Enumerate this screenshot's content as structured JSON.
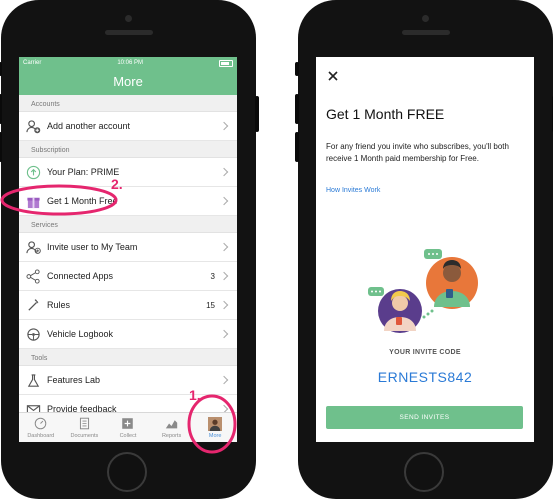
{
  "left_screen": {
    "status": {
      "carrier": "Carrier",
      "time": "10:06 PM"
    },
    "title": "More",
    "sections": {
      "accounts": "Accounts",
      "subscription": "Subscription",
      "services": "Services",
      "tools": "Tools"
    },
    "rows": {
      "add_account": "Add another account",
      "your_plan": "Your Plan: PRIME",
      "get_month": "Get 1 Month Free",
      "invite_team": "Invite user to My Team",
      "connected_apps": "Connected Apps",
      "connected_apps_count": "3",
      "rules": "Rules",
      "rules_count": "15",
      "vehicle_logbook": "Vehicle Logbook",
      "features_lab": "Features Lab",
      "provide_feedback": "Provide feedback"
    },
    "tabs": {
      "dashboard": "Dashboard",
      "documents": "Documents",
      "collect": "Collect",
      "reports": "Reports",
      "more": "More"
    }
  },
  "annotations": {
    "step1": "1.",
    "step2": "2."
  },
  "right_screen": {
    "title": "Get 1 Month FREE",
    "description": "For any friend you invite who subscribes, you'll both receive 1 Month paid membership for Free.",
    "link": "How Invites Work",
    "code_label": "YOUR INVITE CODE",
    "code": "ERNESTS842",
    "send_button": "SEND INVITES"
  },
  "colors": {
    "accent_green": "#6fc08c",
    "link_blue": "#2a7ad6",
    "annotation_pink": "#e5266e"
  },
  "icons": [
    "add-account-icon",
    "plan-icon",
    "gift-icon",
    "invite-user-icon",
    "connected-apps-icon",
    "rules-icon",
    "vehicle-logbook-icon",
    "features-lab-icon",
    "feedback-icon",
    "dashboard-icon",
    "documents-icon",
    "collect-icon",
    "reports-icon",
    "avatar-icon",
    "close-icon"
  ]
}
